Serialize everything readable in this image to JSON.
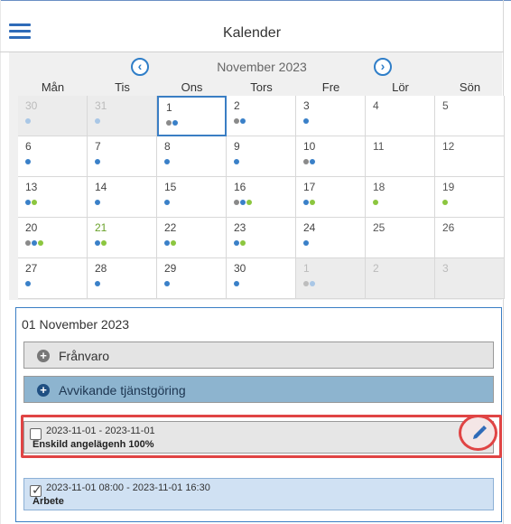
{
  "header": {
    "title": "Kalender",
    "menu_icon": "hamburger-icon"
  },
  "calendar": {
    "month_label": "November 2023",
    "weekdays": [
      "Mån",
      "Tis",
      "Ons",
      "Tors",
      "Fre",
      "Lör",
      "Sön"
    ],
    "days": [
      {
        "n": "30"
      },
      {
        "n": "31"
      },
      {
        "n": "1"
      },
      {
        "n": "2"
      },
      {
        "n": "3"
      },
      {
        "n": "4"
      },
      {
        "n": "5"
      },
      {
        "n": "6"
      },
      {
        "n": "7"
      },
      {
        "n": "8"
      },
      {
        "n": "9"
      },
      {
        "n": "10"
      },
      {
        "n": "11"
      },
      {
        "n": "12"
      },
      {
        "n": "13"
      },
      {
        "n": "14"
      },
      {
        "n": "15"
      },
      {
        "n": "16"
      },
      {
        "n": "17"
      },
      {
        "n": "18"
      },
      {
        "n": "19"
      },
      {
        "n": "20"
      },
      {
        "n": "21"
      },
      {
        "n": "22"
      },
      {
        "n": "23"
      },
      {
        "n": "24"
      },
      {
        "n": "25"
      },
      {
        "n": "26"
      },
      {
        "n": "27"
      },
      {
        "n": "28"
      },
      {
        "n": "29"
      },
      {
        "n": "30"
      },
      {
        "n": "1"
      },
      {
        "n": "2"
      },
      {
        "n": "3"
      }
    ]
  },
  "details": {
    "date_heading": "01 November 2023",
    "absence_label": "Frånvaro",
    "deviation_label": "Avvikande tjänstgöring",
    "items": [
      {
        "range": "2023-11-01 - 2023-11-01",
        "kind": "Enskild angelägenh 100%",
        "checked": false
      },
      {
        "range": "2023-11-01 08:00 - 2023-11-01 16:30",
        "kind": "Arbete",
        "checked": true
      }
    ]
  },
  "colors": {
    "accent": "#2f7ec8",
    "highlight": "#e04444",
    "dot_blue": "#3a80c8",
    "dot_green": "#8cc63f",
    "dot_gray": "#8a8a8a"
  }
}
